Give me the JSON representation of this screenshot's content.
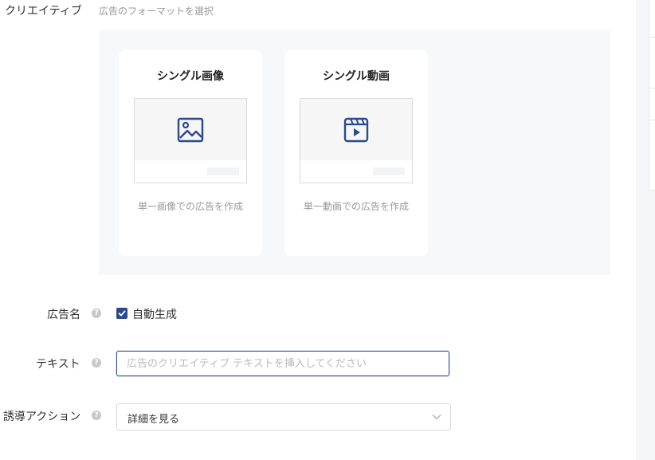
{
  "creative": {
    "label": "クリエイティブ",
    "hint": "広告のフォーマットを選択",
    "formats": [
      {
        "title": "シングル画像",
        "icon": "image-icon",
        "description": "単一画像での広告を作成"
      },
      {
        "title": "シングル動画",
        "icon": "video-icon",
        "description": "単一動画での広告を作成"
      }
    ]
  },
  "ad_name": {
    "label": "広告名",
    "help": "?",
    "auto_generate_label": "自動生成",
    "auto_generate_checked": true
  },
  "text": {
    "label": "テキスト",
    "help": "?",
    "value": "",
    "placeholder": "広告のクリエイティブ テキストを挿入してください"
  },
  "cta": {
    "label": "誘導アクション",
    "help": "?",
    "selected": "詳細を見る"
  },
  "colors": {
    "accent": "#2b4a8b",
    "panel": "#f7f8fa",
    "hint": "#999999"
  }
}
